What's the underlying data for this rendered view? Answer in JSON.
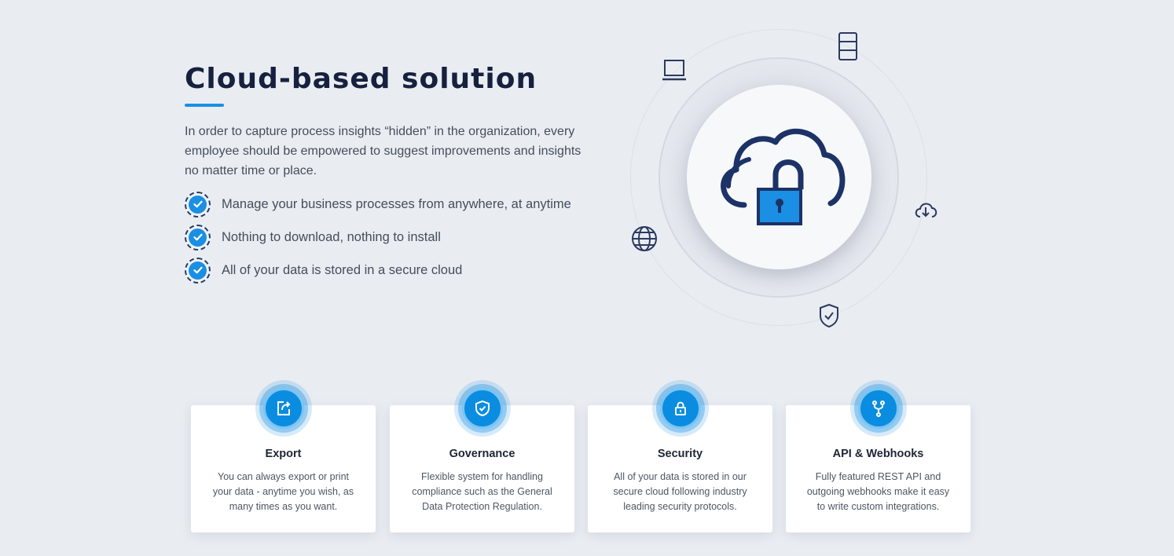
{
  "hero": {
    "title": "Cloud-based solution",
    "intro": "In order to capture process insights “hidden” in the organization, every employee should be empowered to suggest improvements and insights no matter time or place.",
    "features": [
      "Manage your business processes from anywhere, at anytime",
      "Nothing to download, nothing to install",
      "All of your data is stored in a secure cloud"
    ]
  },
  "illustration": {
    "center_icon": "cloud-lock-icon",
    "orbit_icons": [
      "laptop-icon",
      "server-icon",
      "cloud-download-icon",
      "globe-icon",
      "shield-check-icon"
    ]
  },
  "cards": [
    {
      "icon": "export-icon",
      "title": "Export",
      "description": "You can always export or print your data - anytime you wish, as many times as you want."
    },
    {
      "icon": "shield-check-icon",
      "title": "Governance",
      "description": "Flexible system for handling compliance such as the General Data Protection Regulation."
    },
    {
      "icon": "lock-icon",
      "title": "Security",
      "description": "All of your data is stored in our secure cloud following industry leading security protocols."
    },
    {
      "icon": "fork-icon",
      "title": "API & Webhooks",
      "description": "Fully featured REST API and outgoing webhooks make it easy to write custom integrations."
    }
  ],
  "colors": {
    "accent": "#1a8fe3",
    "title": "#16213f",
    "background": "#e9edf2",
    "icon_dark": "#1d3266"
  }
}
